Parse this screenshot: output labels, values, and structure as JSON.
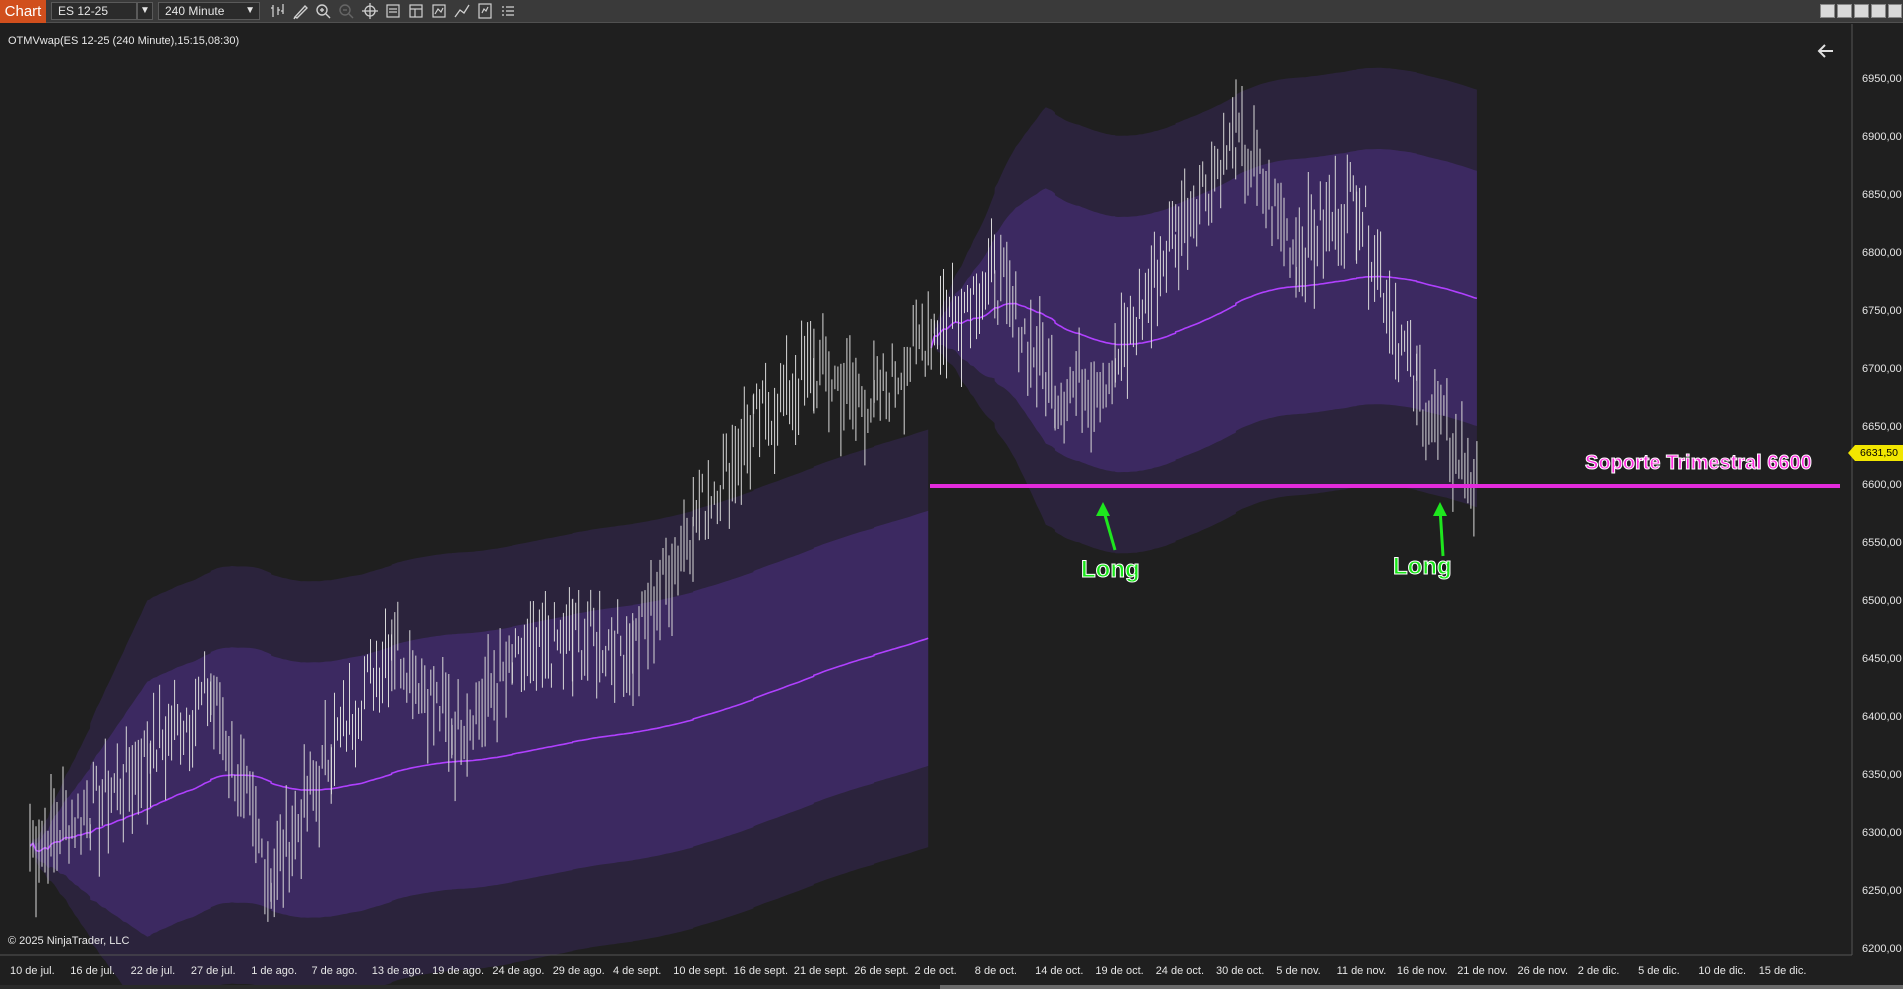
{
  "toolbar": {
    "tab_label": "Chart",
    "instrument": "ES 12-25",
    "interval": "240 Minute",
    "icons": [
      "bar-type-icon",
      "draw-pencil-icon",
      "zoom-in-icon",
      "zoom-out-icon",
      "crosshair-icon",
      "properties-icon",
      "template-icon",
      "data-box-icon",
      "indicators-icon",
      "strategies-icon",
      "more-menu-icon"
    ],
    "window_buttons": [
      "tile-window",
      "tile-window-2",
      "minimize-window",
      "restore-window",
      "close-window"
    ]
  },
  "chart": {
    "indicator_label": "OTMVwap(ES 12-25 (240 Minute),15:15,08:30)",
    "copyright": "© 2025 NinjaTrader, LLC",
    "current_price": "6631,50",
    "colors": {
      "background": "#1f1f1f",
      "candles": "#d8d8d8",
      "vwap_line": "#b040ff",
      "bands": "#4a2f80",
      "support_line": "#e32bdc",
      "annotation_arrow": "#1ee61e"
    }
  },
  "chart_data": {
    "type": "candlestick",
    "instrument": "ES 12-25",
    "interval": "240 Minute",
    "price_axis": {
      "labels": [
        "6950,00",
        "6900,00",
        "6850,00",
        "6800,00",
        "6750,00",
        "6700,00",
        "6650,00",
        "6600,00",
        "6550,00",
        "6500,00",
        "6450,00",
        "6400,00",
        "6350,00",
        "6300,00",
        "6250,00",
        "6200,00"
      ],
      "range": [
        6200,
        6975
      ]
    },
    "time_axis": {
      "labels": [
        "10 de jul.",
        "16 de jul.",
        "22 de jul.",
        "27 de jul.",
        "1 de ago.",
        "7 de ago.",
        "13 de ago.",
        "19 de ago.",
        "24 de ago.",
        "29 de ago.",
        "4 de sept.",
        "10 de sept.",
        "16 de sept.",
        "21 de sept.",
        "26 de sept.",
        "2 de oct.",
        "8 de oct.",
        "14 de oct.",
        "19 de oct.",
        "24 de oct.",
        "30 de oct.",
        "5 de nov.",
        "11 de nov.",
        "16 de nov.",
        "21 de nov.",
        "26 de nov.",
        "2 de dic.",
        "5 de dic.",
        "10 de dic.",
        "15 de dic."
      ]
    },
    "price_path": [
      [
        "10 de jul.",
        6290
      ],
      [
        "16 de jul.",
        6320
      ],
      [
        "22 de jul.",
        6370
      ],
      [
        "27 de jul.",
        6420
      ],
      [
        "1 de ago.",
        6260
      ],
      [
        "7 de ago.",
        6370
      ],
      [
        "13 de ago.",
        6470
      ],
      [
        "19 de ago.",
        6390
      ],
      [
        "24 de ago.",
        6440
      ],
      [
        "29 de ago.",
        6470
      ],
      [
        "4 de sept.",
        6460
      ],
      [
        "10 de sept.",
        6570
      ],
      [
        "16 de sept.",
        6650
      ],
      [
        "21 de sept.",
        6700
      ],
      [
        "26 de sept.",
        6670
      ],
      [
        "2 de oct.",
        6740
      ],
      [
        "8 de oct.",
        6780
      ],
      [
        "14 de oct.",
        6680
      ],
      [
        "19 de oct.",
        6700
      ],
      [
        "24 de oct.",
        6820
      ],
      [
        "30 de oct.",
        6900
      ],
      [
        "5 de nov.",
        6800
      ],
      [
        "11 de nov.",
        6850
      ],
      [
        "16 de nov.",
        6680
      ],
      [
        "21 de nov.",
        6600
      ]
    ],
    "annotations": [
      {
        "type": "horizontal_line",
        "price": 6600,
        "label": "Soporte Trimestral 6600"
      },
      {
        "type": "arrow",
        "label": "Long",
        "date": "14 de oct.",
        "price": 6600
      },
      {
        "type": "arrow",
        "label": "Long",
        "date": "16 de nov.",
        "price": 6600
      }
    ]
  }
}
